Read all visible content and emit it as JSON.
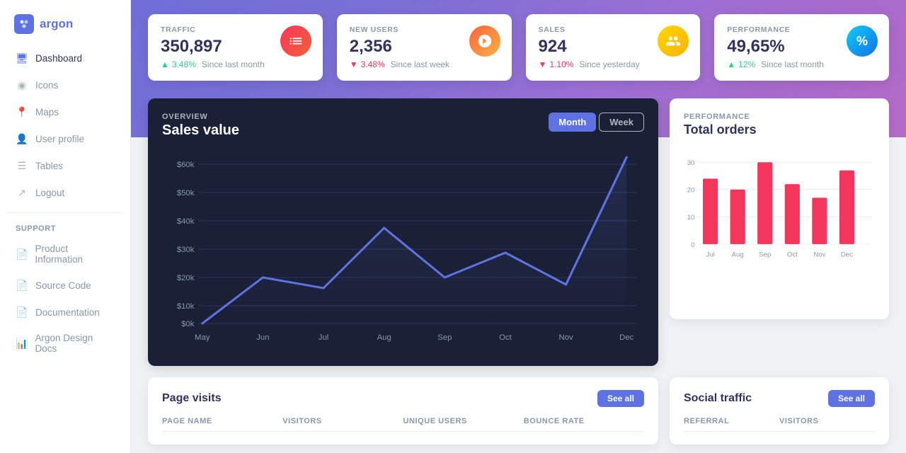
{
  "sidebar": {
    "logo_text": "argon",
    "nav_items": [
      {
        "label": "Dashboard",
        "icon": "🖥",
        "active": true
      },
      {
        "label": "Icons",
        "icon": "◉",
        "active": false
      },
      {
        "label": "Maps",
        "icon": "📍",
        "active": false
      },
      {
        "label": "User profile",
        "icon": "👤",
        "active": false
      },
      {
        "label": "Tables",
        "icon": "☰",
        "active": false
      },
      {
        "label": "Logout",
        "icon": "↗",
        "active": false
      }
    ],
    "support_label": "SUPPORT",
    "support_items": [
      {
        "label": "Product Information",
        "icon": "📄"
      },
      {
        "label": "Source Code",
        "icon": "📄"
      },
      {
        "label": "Documentation",
        "icon": "📄"
      },
      {
        "label": "Argon Design Docs",
        "icon": "📊"
      }
    ]
  },
  "stats": [
    {
      "label": "TRAFFIC",
      "value": "350,897",
      "change": "3.48%",
      "since": "Since last month",
      "direction": "up",
      "icon_char": "📊",
      "icon_class": "icon-pink"
    },
    {
      "label": "NEW USERS",
      "value": "2,356",
      "change": "3.48%",
      "since": "Since last week",
      "direction": "down",
      "icon_char": "🥧",
      "icon_class": "icon-orange"
    },
    {
      "label": "SALES",
      "value": "924",
      "change": "1.10%",
      "since": "Since yesterday",
      "direction": "down",
      "icon_char": "👥",
      "icon_class": "icon-yellow"
    },
    {
      "label": "PERFORMANCE",
      "value": "49,65%",
      "change": "12%",
      "since": "Since last month",
      "direction": "up",
      "icon_char": "%",
      "icon_class": "icon-cyan"
    }
  ],
  "sales_chart": {
    "overview_label": "OVERVIEW",
    "title": "Sales value",
    "btn_month": "Month",
    "btn_week": "Week",
    "y_labels": [
      "$60k",
      "$50k",
      "$40k",
      "$30k",
      "$20k",
      "$10k",
      "$0k"
    ],
    "x_labels": [
      "May",
      "Jun",
      "Jul",
      "Aug",
      "Sep",
      "Oct",
      "Nov",
      "Dec"
    ]
  },
  "perf_chart": {
    "label": "PERFORMANCE",
    "title": "Total orders",
    "bars": [
      {
        "label": "Jul",
        "value": 24,
        "max": 30
      },
      {
        "label": "Aug",
        "value": 20,
        "max": 30
      },
      {
        "label": "Sep",
        "value": 30,
        "max": 30
      },
      {
        "label": "Oct",
        "value": 22,
        "max": 30
      },
      {
        "label": "Nov",
        "value": 17,
        "max": 30
      },
      {
        "label": "Dec",
        "value": 27,
        "max": 30
      }
    ],
    "y_labels": [
      "30",
      "20",
      "10",
      "0"
    ]
  },
  "page_visits": {
    "title": "Page visits",
    "see_all": "See all",
    "columns": [
      "PAGE NAME",
      "VISITORS",
      "UNIQUE USERS",
      "BOUNCE RATE"
    ]
  },
  "social_traffic": {
    "title": "Social traffic",
    "see_all": "See all",
    "columns": [
      "REFERRAL",
      "VISITORS"
    ]
  }
}
